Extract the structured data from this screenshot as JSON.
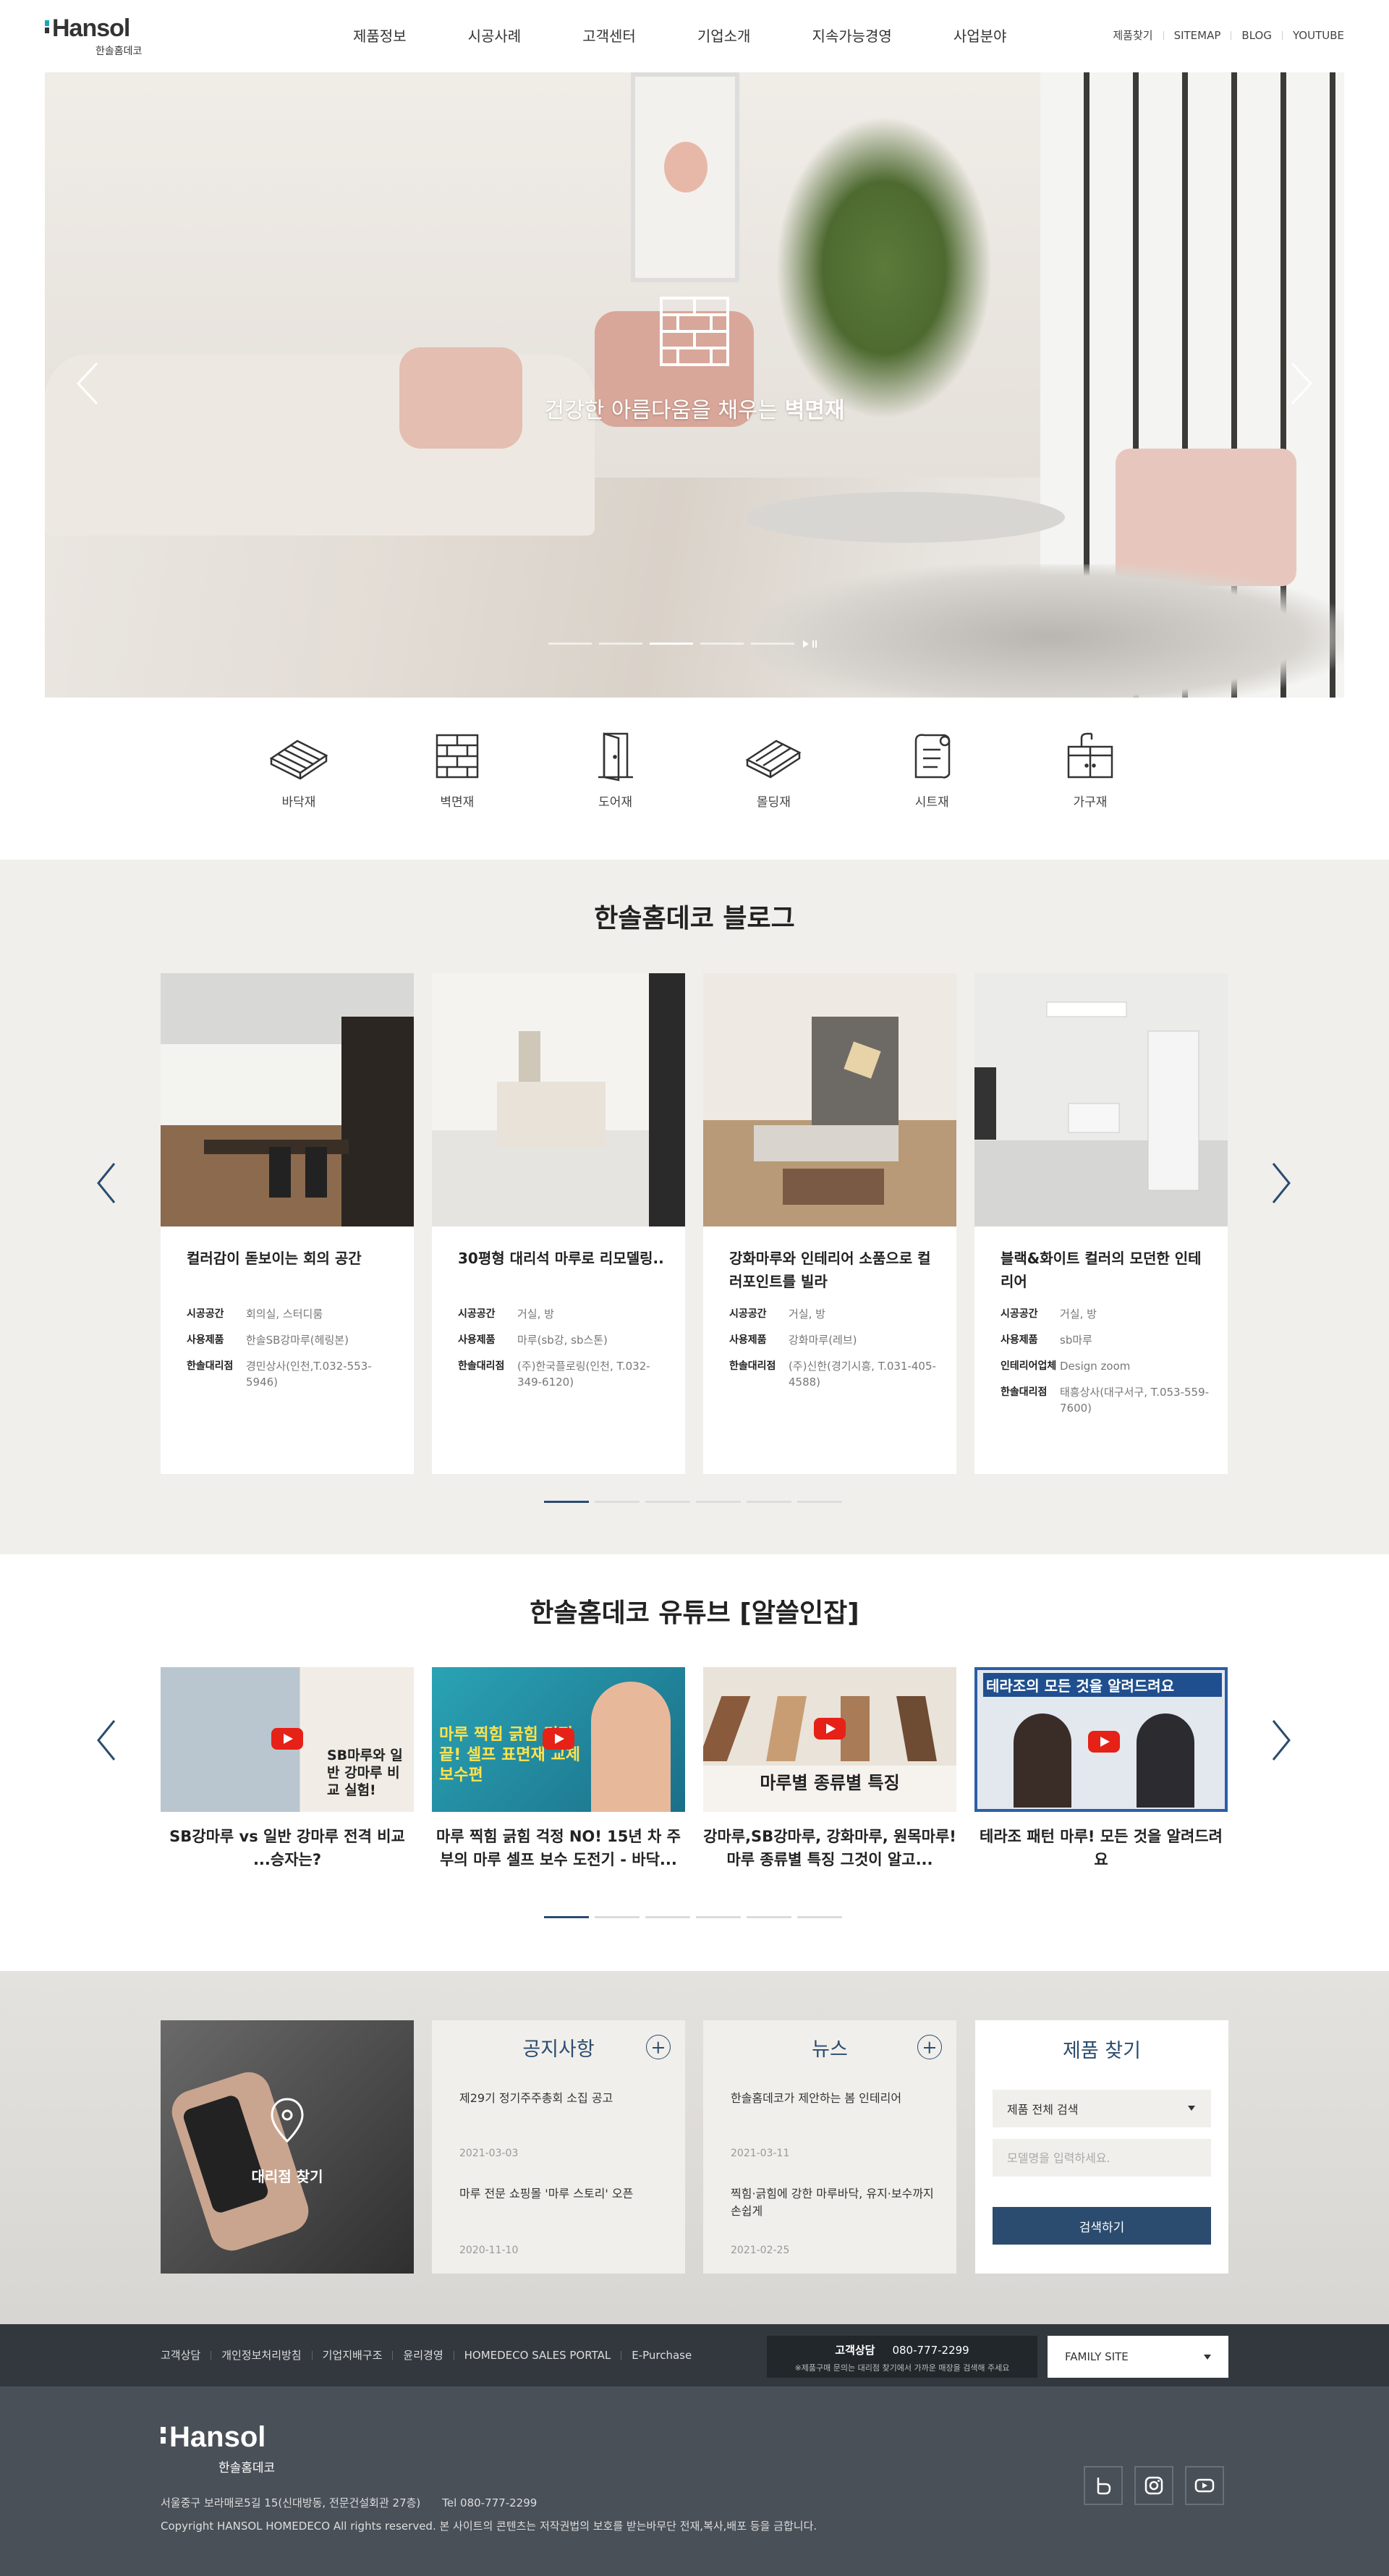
{
  "header": {
    "logo": {
      "brand": "Hansol",
      "sub": "한솔홈데코"
    },
    "gnb": [
      "제품정보",
      "시공사례",
      "고객센터",
      "기업소개",
      "지속가능경영",
      "사업분야"
    ],
    "util": [
      "제품찾기",
      "SITEMAP",
      "BLOG",
      "YOUTUBE"
    ]
  },
  "hero": {
    "headline_pre": "건강한 아름다움을 채우는 ",
    "headline_bold": "벽면재",
    "slide_count": 6,
    "active_slide": 3,
    "icon": "brick-wall-icon"
  },
  "categories": [
    {
      "label": "바닥재",
      "icon": "flooring-icon"
    },
    {
      "label": "벽면재",
      "icon": "brick-wall-icon"
    },
    {
      "label": "도어재",
      "icon": "door-icon"
    },
    {
      "label": "몰딩재",
      "icon": "molding-icon"
    },
    {
      "label": "시트재",
      "icon": "sheet-roll-icon"
    },
    {
      "label": "가구재",
      "icon": "cabinet-icon"
    }
  ],
  "blog": {
    "title": "한솔홈데코 블로그",
    "cards": [
      {
        "title": "컬러감이 돋보이는 회의 공간",
        "meta": [
          [
            "시공공간",
            "회의실, 스터디룸"
          ],
          [
            "사용제품",
            "한솔SB강마루(헤링본)"
          ],
          [
            "한솔대리점",
            "경민상사(인천,T.032-553-5946)"
          ]
        ]
      },
      {
        "title": "30평형 대리석 마루로 리모델링..",
        "meta": [
          [
            "시공공간",
            "거실, 방"
          ],
          [
            "사용제품",
            "마루(sb강, sb스톤)"
          ],
          [
            "한솔대리점",
            "(주)한국플로링(인천, T.032-349-6120)"
          ]
        ]
      },
      {
        "title": "강화마루와 인테리어 소품으로 컬러포인트를 빌라",
        "meta": [
          [
            "시공공간",
            "거실, 방"
          ],
          [
            "사용제품",
            "강화마루(레브)"
          ],
          [
            "한솔대리점",
            "(주)신한(경기시흥, T.031-405-4588)"
          ]
        ]
      },
      {
        "title": "블랙&화이트 컬러의 모던한 인테리어",
        "meta": [
          [
            "시공공간",
            "거실, 방"
          ],
          [
            "사용제품",
            "sb마루"
          ],
          [
            "인테리어업체",
            "Design zoom"
          ],
          [
            "한솔대리점",
            "태흥상사(대구서구, T.053-559-7600)"
          ]
        ]
      }
    ],
    "page_count": 6,
    "active_page": 1
  },
  "youtube": {
    "title": "한솔홈데코 유튜브 [알쓸인잡]",
    "videos": [
      {
        "title": "SB강마루 vs 일반 강마루 전격 비교 ...승자는?",
        "thumb_text": "SB마루와 일반 강마루 비교 실험!"
      },
      {
        "title": "마루 찍힘 긁힘 걱정 NO! 15년 차 주부의 마루 셀프 보수 도전기 - 바닥...",
        "thumb_text": "마루 찍힘 긁힘 걱정 끝! 셀프 표면재 교체 보수편"
      },
      {
        "title": "강마루,SB강마루, 강화마루, 원목마루! 마루 종류별 특징 그것이 알고...",
        "thumb_text": "마루별 종류별 특징"
      },
      {
        "title": "테라조 패턴 마루! 모든 것을 알려드려요",
        "thumb_text": "테라조의 모든 것을 알려드려요"
      }
    ],
    "page_count": 6,
    "active_page": 1
  },
  "info": {
    "agent_label": "대리점 찾기",
    "notice": {
      "title": "공지사항",
      "items": [
        {
          "text": "제29기 정기주주총회 소집 공고",
          "date": "2021-03-03"
        },
        {
          "text": "마루 전문 쇼핑몰 '마루 스토리' 오픈",
          "date": "2020-11-10"
        }
      ]
    },
    "news": {
      "title": "뉴스",
      "items": [
        {
          "text": "한솔홈데코가 제안하는 봄 인테리어",
          "date": "2021-03-11"
        },
        {
          "text": "찍힘·긁힘에 강한 마루바닥, 유지·보수까지 손쉽게",
          "date": "2021-02-25"
        }
      ]
    },
    "search": {
      "title": "제품 찾기",
      "select_value": "제품 전체 검색",
      "input_placeholder": "모델명을 입력하세요.",
      "button": "검색하기"
    }
  },
  "footer": {
    "links": [
      "고객상담",
      "개인정보처리방침",
      "기업지배구조",
      "윤리경영",
      "HOMEDECO SALES PORTAL",
      "E-Purchase"
    ],
    "cs_label": "고객상담",
    "cs_phone": "080-777-2299",
    "cs_note": "※제품구매 문의는 대리점 찾기에서 가까운 매장을 검색해 주세요",
    "family_site": "FAMILY SITE",
    "logo_brand": "Hansol",
    "logo_sub": "한솔홈데코",
    "address": "서울중구 보라매로5길 15(신대방동, 전문건설회관 27층)",
    "tel": "Tel 080-777-2299",
    "copyright": "Copyright HANSOL HOMEDECO All rights reserved. 본 사이트의 콘텐츠는 저작권법의 보호를 받는바무단 전재,복사,배포 등을 금합니다.",
    "sns": [
      "blog-icon",
      "instagram-icon",
      "youtube-icon"
    ]
  },
  "colors": {
    "accent": "#2b4c6f",
    "logo_teal": "#1aa7b3",
    "footer_dark": "#4a5058",
    "footer_bar": "#33383e",
    "section_bg": "#f0efeb"
  }
}
